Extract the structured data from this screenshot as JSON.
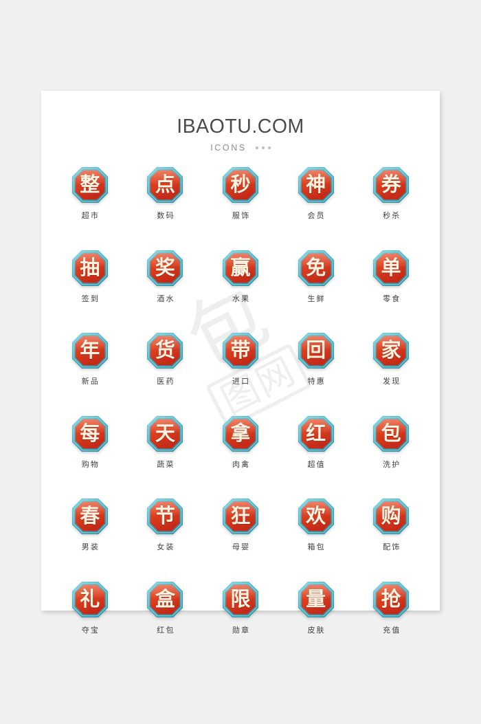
{
  "page": {
    "background_color": "#f0f0f0",
    "card_color": "#ffffff"
  },
  "header": {
    "title": "IBAOTU.COM",
    "subtitle": "ICONS",
    "dot_count": 3
  },
  "watermark": {
    "glyph": "包",
    "boxed_text": "图网"
  },
  "theme": {
    "border_outer": "#2f8fa3",
    "border_light": "#7fd2de",
    "border_mid": "#49adc0",
    "face_top": "#e8512a",
    "face_bottom": "#c42a18",
    "char_color": "#fdf3e3",
    "label_color": "#3f3f3f"
  },
  "icons": [
    {
      "char": "整",
      "label": "超市"
    },
    {
      "char": "点",
      "label": "数码"
    },
    {
      "char": "秒",
      "label": "服饰"
    },
    {
      "char": "神",
      "label": "会员"
    },
    {
      "char": "券",
      "label": "秒杀"
    },
    {
      "char": "抽",
      "label": "签到"
    },
    {
      "char": "奖",
      "label": "酒水"
    },
    {
      "char": "赢",
      "label": "水果"
    },
    {
      "char": "免",
      "label": "生鲜"
    },
    {
      "char": "单",
      "label": "零食"
    },
    {
      "char": "年",
      "label": "新品"
    },
    {
      "char": "货",
      "label": "医药"
    },
    {
      "char": "带",
      "label": "进口"
    },
    {
      "char": "回",
      "label": "特惠"
    },
    {
      "char": "家",
      "label": "发现"
    },
    {
      "char": "每",
      "label": "购物"
    },
    {
      "char": "天",
      "label": "蔬菜"
    },
    {
      "char": "拿",
      "label": "肉禽"
    },
    {
      "char": "红",
      "label": "超值"
    },
    {
      "char": "包",
      "label": "洗护"
    },
    {
      "char": "春",
      "label": "男装"
    },
    {
      "char": "节",
      "label": "女装"
    },
    {
      "char": "狂",
      "label": "母婴"
    },
    {
      "char": "欢",
      "label": "箱包"
    },
    {
      "char": "购",
      "label": "配饰"
    },
    {
      "char": "礼",
      "label": "夺宝"
    },
    {
      "char": "盒",
      "label": "红包"
    },
    {
      "char": "限",
      "label": "勋章"
    },
    {
      "char": "量",
      "label": "皮肤"
    },
    {
      "char": "抢",
      "label": "充值"
    }
  ]
}
